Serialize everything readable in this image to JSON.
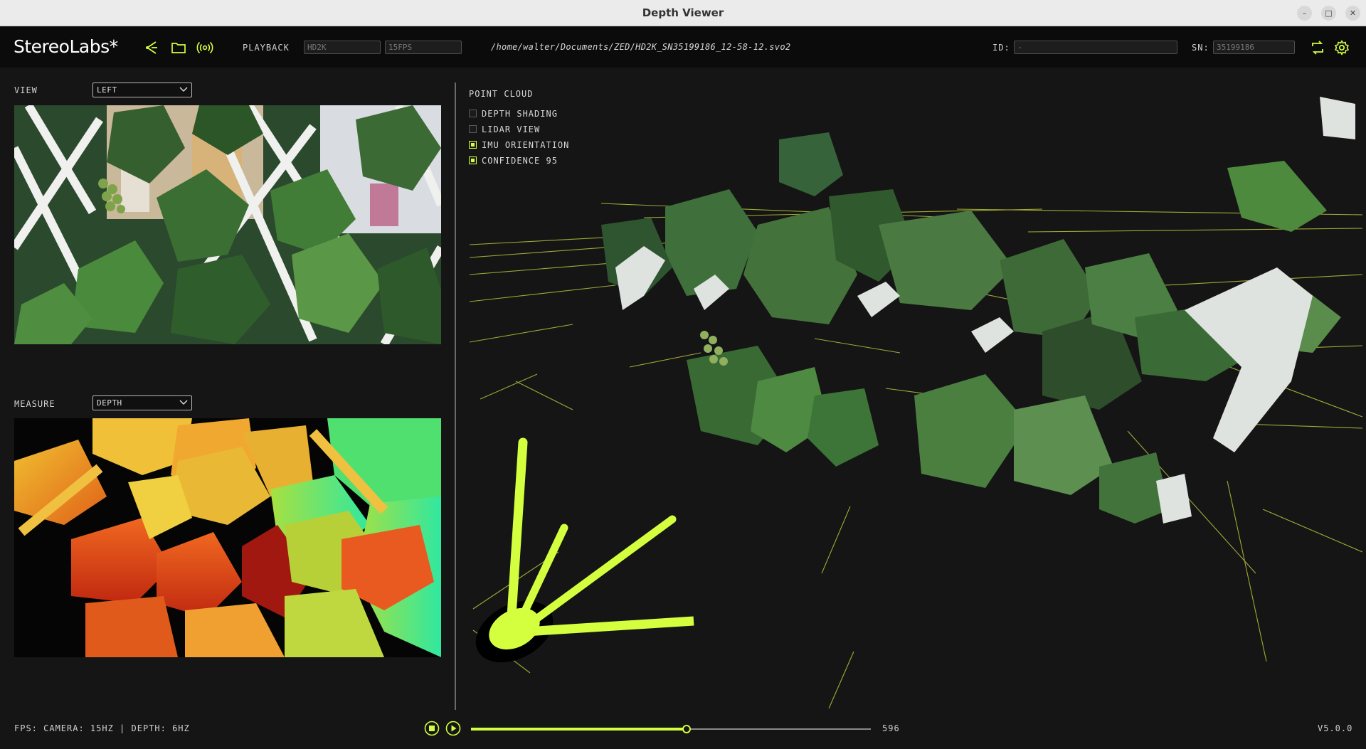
{
  "window": {
    "title": "Depth Viewer"
  },
  "toolbar": {
    "logo": "StereoLabs*",
    "mode_label": "PLAYBACK",
    "resolution_value": "HD2K",
    "fps_value": "15FPS",
    "file_path": "/home/walter/Documents/ZED/HD2K_SN35199186_12-58-12.svo2",
    "id_label": "ID:",
    "id_value": "-",
    "sn_label": "SN:",
    "sn_value": "35199186"
  },
  "left_panel": {
    "view_label": "VIEW",
    "view_selected": "LEFT",
    "measure_label": "MEASURE",
    "measure_selected": "DEPTH"
  },
  "point_cloud": {
    "title": "POINT CLOUD",
    "options": [
      {
        "label": "DEPTH SHADING",
        "checked": false
      },
      {
        "label": "LIDAR VIEW",
        "checked": false
      },
      {
        "label": "IMU ORIENTATION",
        "checked": true
      },
      {
        "label": "CONFIDENCE 95",
        "checked": true
      }
    ]
  },
  "status_bar": {
    "fps_text": "FPS: CAMERA: 15HZ | DEPTH: 6HZ",
    "frame_number": "596",
    "version": "V5.0.0",
    "progress_fraction": 0.54
  },
  "colors": {
    "accent": "#d4ff3f",
    "background": "#151515",
    "toolbar": "#0b0b0b"
  }
}
